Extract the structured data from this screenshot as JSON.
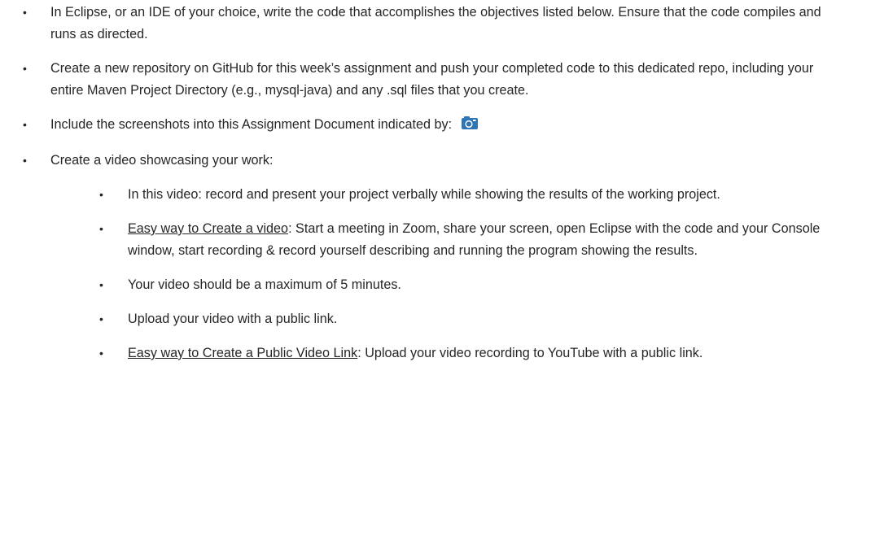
{
  "bullets": {
    "symbol": "•"
  },
  "items": [
    {
      "text": "In Eclipse, or an IDE of your choice, write the code that accomplishes the objectives listed below. Ensure that the code compiles and runs as directed."
    },
    {
      "text": "Create a new repository on GitHub for this week’s assignment and push your completed code to this dedicated repo, including your entire Maven Project Directory (e.g., mysql-java) and any .sql files that you create."
    },
    {
      "text": "Include the screenshots into this Assignment Document indicated by:",
      "icon": "camera-icon",
      "icon_color": "#2e75b6"
    },
    {
      "text": "Create a video showcasing your work:"
    }
  ],
  "subitems": [
    {
      "text": "In this video: record and present your project verbally while showing the results of the working project."
    },
    {
      "underlined": "Easy way to Create a video",
      "text": ":  Start a meeting in Zoom, share your screen, open Eclipse with the code and your Console window, start recording & record yourself describing and running the program showing the results."
    },
    {
      "text": "Your video should be a maximum of 5 minutes."
    },
    {
      "text": "Upload your video with a public link."
    },
    {
      "underlined": "Easy way to Create a Public Video Link",
      "text": ":  Upload your video recording to YouTube with a public link."
    }
  ]
}
